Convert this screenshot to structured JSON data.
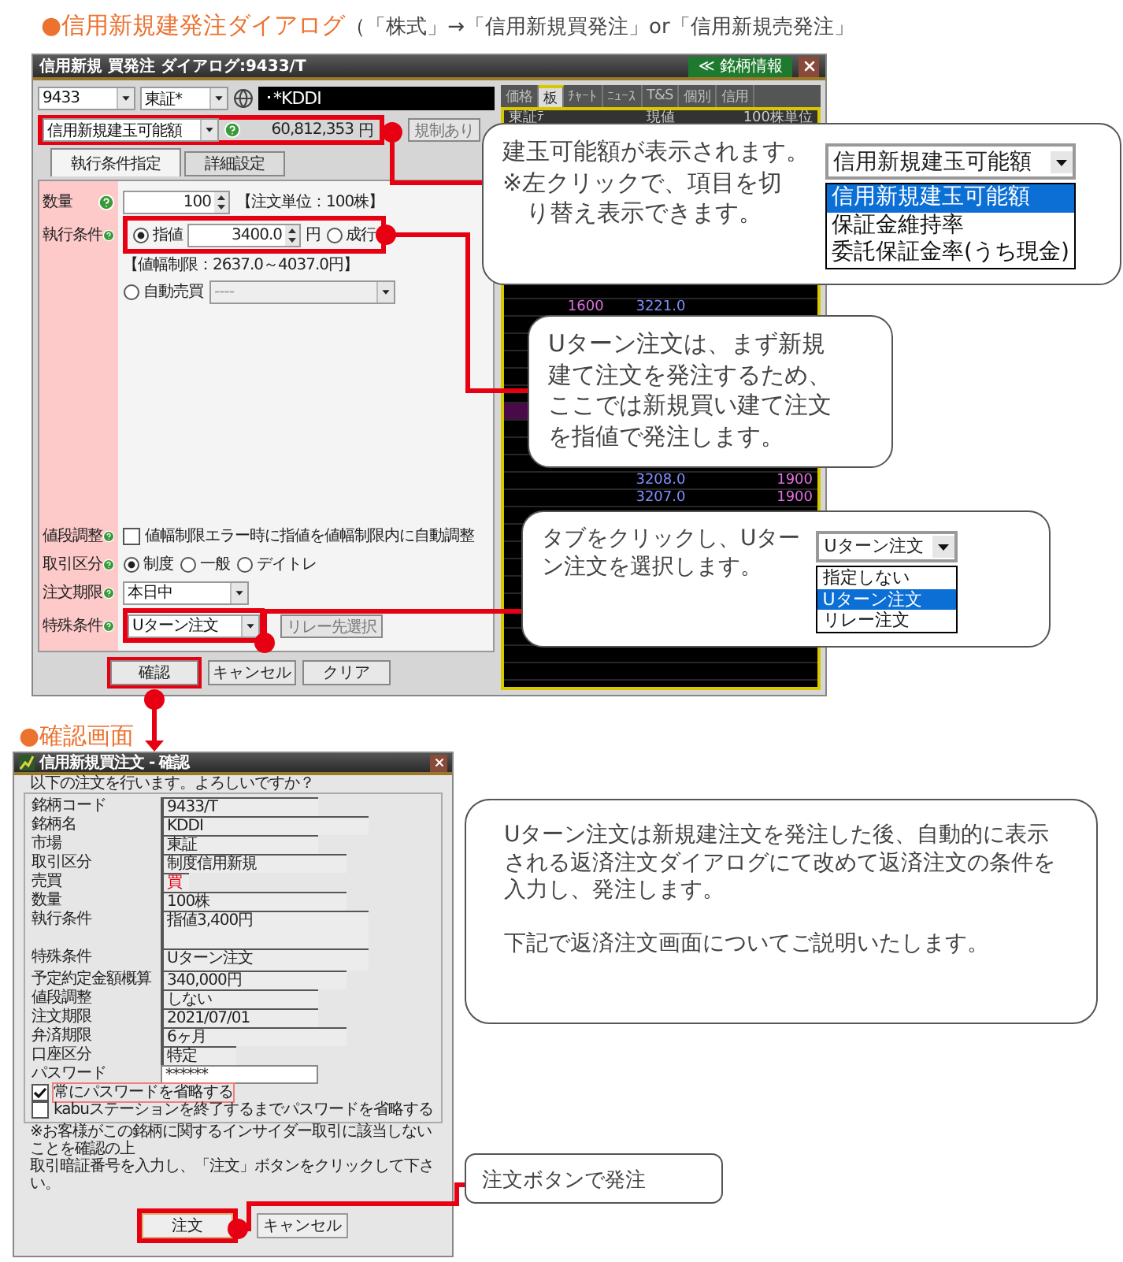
{
  "heading": {
    "title": "●信用新規建発注ダイアログ",
    "path": "（「株式」→「信用新規買発注」or「信用新規売発注」"
  },
  "order_dialog": {
    "title": "信用新規 買発注 ダイアログ:9433/T",
    "info_button": "≪ 銘柄情報",
    "symbol": "9433",
    "market": "東証*",
    "name": "･*KDDI",
    "display_select": "信用新規建玉可能額",
    "amount": "60,812,353",
    "amount_unit": "円",
    "regulation_button": "規制あり",
    "tabs": [
      {
        "label": "執行条件指定",
        "selected": true
      },
      {
        "label": "詳細設定",
        "selected": false
      }
    ],
    "quantity": {
      "label": "数量",
      "value": "100",
      "unit_note": "【注文単位：100株】"
    },
    "execution": {
      "label": "執行条件",
      "price": "3400.0",
      "price_unit": "円",
      "limit_note": "【値幅制限：2637.0～4037.0円】",
      "options": [
        {
          "label": "指値",
          "selected": true
        },
        {
          "label": "成行",
          "selected": false
        }
      ],
      "auto": {
        "label": "自動売買",
        "selected": false,
        "select": "----"
      }
    },
    "price_adjust": {
      "label": "値段調整",
      "text": "値幅制限エラー時に指値を値幅制限内に自動調整",
      "checked": false
    },
    "trade_type": {
      "label": "取引区分",
      "options": [
        {
          "label": "制度",
          "selected": true
        },
        {
          "label": "一般",
          "selected": false
        },
        {
          "label": "デイトレ",
          "selected": false
        }
      ]
    },
    "expiry": {
      "label": "注文期限",
      "value": "本日中"
    },
    "special": {
      "label": "特殊条件",
      "value": "Uターン注文",
      "relay_button": "リレー先選択"
    },
    "buttons": [
      "確認",
      "キャンセル",
      "クリア"
    ],
    "board": {
      "tabs": [
        {
          "label": "価格",
          "selected": false
        },
        {
          "label": "板",
          "selected": true
        },
        {
          "label": "ﾁｬｰﾄ",
          "selected": false
        },
        {
          "label": "ﾆｭｰｽ",
          "selected": false
        },
        {
          "label": "T&S",
          "selected": false
        },
        {
          "label": "個別",
          "selected": false
        },
        {
          "label": "信用",
          "selected": false
        }
      ],
      "header": [
        "東証ﾃ",
        "現値",
        "100株単位"
      ],
      "rows": [
        {
          "sell": "1600",
          "price": "3221.0"
        },
        {
          "price": "3208.0",
          "buy": "1900"
        },
        {
          "price": "3207.0",
          "buy": "1900"
        }
      ]
    }
  },
  "callouts": [
    {
      "kind": "dropdown",
      "lines": [
        "建玉可能額が表示されます。",
        "※左クリックで、項目を切",
        "　り替え表示できます。"
      ],
      "dropdown": {
        "value": "信用新規建玉可能額",
        "options": [
          {
            "label": "信用新規建玉可能額",
            "selected": true
          },
          {
            "label": "保証金維持率",
            "selected": false
          },
          {
            "label": "委託保証金率(うち現金)",
            "selected": false
          }
        ]
      }
    },
    {
      "kind": "text",
      "lines": [
        "Uターン注文は、まず新規",
        "建て注文を発注するため、",
        "ここでは新規買い建て注文",
        "を指値で発注します。"
      ]
    },
    {
      "kind": "dropdown",
      "lines": [
        "タブをクリックし、Uター",
        "ン注文を選択します。"
      ],
      "dropdown": {
        "value": "Uターン注文",
        "options": [
          {
            "label": "指定しない",
            "selected": false
          },
          {
            "label": "Uターン注文",
            "selected": true
          },
          {
            "label": "リレー注文",
            "selected": false
          }
        ]
      }
    }
  ],
  "confirm_heading": "●確認画面",
  "confirm_dialog": {
    "title": "信用新規買注文 - 確認",
    "prompt": "以下の注文を行います。よろしいですか？",
    "fields": [
      {
        "label": "銘柄コード",
        "value": "9433/T",
        "kind": "short"
      },
      {
        "label": "銘柄名",
        "value": "KDDI",
        "kind": "long"
      },
      {
        "label": "市場",
        "value": "東証",
        "kind": "short"
      },
      {
        "label": "取引区分",
        "value": "制度信用新規",
        "kind": "medium"
      },
      {
        "label": "売買",
        "value": "買",
        "kind": "mark"
      },
      {
        "label": "数量",
        "value": "100株",
        "kind": "medium"
      },
      {
        "label": "執行条件",
        "value": "指値3,400円",
        "kind": "area"
      },
      {
        "label": "特殊条件",
        "value": "Uターン注文",
        "kind": "smallarea"
      },
      {
        "label": "予定約定金額概算",
        "value": "340,000円",
        "kind": "medium"
      },
      {
        "label": "値段調整",
        "value": "しない",
        "kind": "short"
      },
      {
        "label": "注文期限",
        "value": "2021/07/01",
        "kind": "short"
      },
      {
        "label": "弁済期限",
        "value": "6ヶ月",
        "kind": "medium"
      },
      {
        "label": "口座区分",
        "value": "特定",
        "kind": "tiny"
      }
    ],
    "password": {
      "label": "パスワード",
      "value": "******"
    },
    "options": [
      {
        "label": "常にパスワードを省略する",
        "checked": true
      },
      {
        "label": "kabuステーションを終了するまでパスワードを省略する",
        "checked": false
      }
    ],
    "note_lines": [
      "※お客様がこの銘柄に関するインサイダー取引に該当しないことを確認の上",
      "取引暗証番号を入力し、「注文」ボタンをクリックして下さい。"
    ],
    "buttons": [
      "注文",
      "キャンセル"
    ]
  },
  "info_box": {
    "paragraphs": [
      "Uターン注文は新規建注文を発注した後、自動的に表示される返済注文ダイアログにて改めて返済注文の条件を入力し、発注します。",
      "下記で返済注文画面についてご説明いたします。"
    ]
  },
  "confirm_callout": "注文ボタンで発注"
}
